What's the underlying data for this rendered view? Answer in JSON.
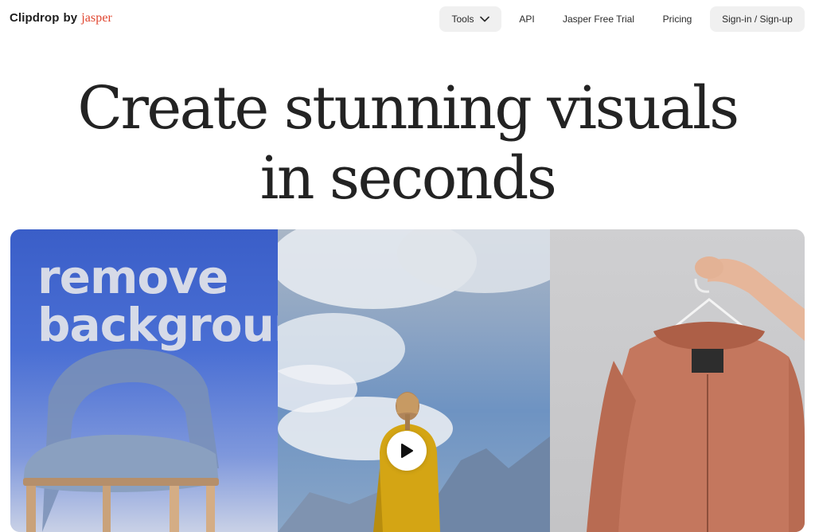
{
  "brand": {
    "name": "Clipdrop",
    "by": "by",
    "partner": "jasper",
    "partner_color": "#e0442e"
  },
  "nav": {
    "tools_label": "Tools",
    "api_label": "API",
    "trial_label": "Jasper Free Trial",
    "pricing_label": "Pricing",
    "signin_label": "Sign-in / Sign-up"
  },
  "hero": {
    "title_line1": "Create stunning visuals",
    "title_line2": "in seconds",
    "overlay_line1": "remove",
    "overlay_line2": "background"
  },
  "icons": {
    "tools_chevron": "chevron-down-icon",
    "play": "play-icon"
  },
  "colors": {
    "page_bg": "#ffffff",
    "pill_bg": "#f0f0f0",
    "text": "#1f1f1f"
  }
}
